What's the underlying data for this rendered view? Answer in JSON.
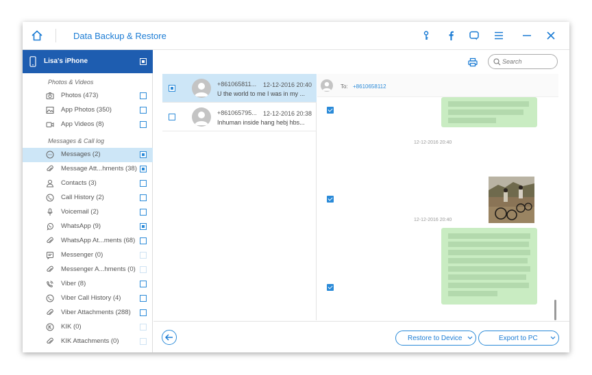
{
  "app": {
    "title": "Data Backup & Restore"
  },
  "device": {
    "name": "Lisa's iPhone"
  },
  "sidebar": {
    "categories": [
      "Photos & Videos",
      "Messages & Call log"
    ],
    "items": [
      {
        "label": "Photos (473)",
        "icon": "camera-icon",
        "checked": false
      },
      {
        "label": "App Photos (350)",
        "icon": "image-icon",
        "checked": false
      },
      {
        "label": "App Videos (8)",
        "icon": "video-icon",
        "checked": false
      },
      {
        "label": "Messages (2)",
        "icon": "message-icon",
        "checked": true
      },
      {
        "label": "Message Att...hments (38)",
        "icon": "paperclip-icon",
        "checked": true
      },
      {
        "label": "Contacts (3)",
        "icon": "person-icon",
        "checked": false
      },
      {
        "label": "Call History (2)",
        "icon": "phone-icon",
        "checked": false
      },
      {
        "label": "Voicemail (2)",
        "icon": "microphone-icon",
        "checked": false
      },
      {
        "label": "WhatsApp (9)",
        "icon": "whatsapp-icon",
        "checked": true
      },
      {
        "label": "WhatsApp At...ments (68)",
        "icon": "paperclip-icon",
        "checked": false
      },
      {
        "label": "Messenger (0)",
        "icon": "messenger-icon",
        "checked": false
      },
      {
        "label": "Messenger A...hments (0)",
        "icon": "paperclip-icon",
        "checked": false
      },
      {
        "label": "Viber (8)",
        "icon": "viber-icon",
        "checked": false
      },
      {
        "label": "Viber Call History (4)",
        "icon": "phone-icon",
        "checked": false
      },
      {
        "label": "Viber Attachments (288)",
        "icon": "paperclip-icon",
        "checked": false
      },
      {
        "label": "KIK (0)",
        "icon": "kik-icon",
        "checked": false
      },
      {
        "label": "KIK Attachments (0)",
        "icon": "paperclip-icon",
        "checked": false
      }
    ]
  },
  "search": {
    "placeholder": "Search"
  },
  "conversations": [
    {
      "number": "+861065811...",
      "date": "12-12-2016 20:40",
      "preview": "U the world to me I was in my ..."
    },
    {
      "number": "+861065795...",
      "date": "12-12-2016 20:38",
      "preview": "Inhuman inside hang hebj hbs..."
    }
  ],
  "detail": {
    "to_label": "To:",
    "to_number": "+8610658112",
    "timestamps": [
      "12-12-2016 20:40",
      "12-12-2016 20:40"
    ]
  },
  "buttons": {
    "restore": "Restore to Device",
    "export": "Export to PC"
  },
  "colors": {
    "accent": "#2a8ad8",
    "header_blue": "#1e5db0",
    "selection": "#cde6f7",
    "bubble_green": "#c9ecc2"
  }
}
